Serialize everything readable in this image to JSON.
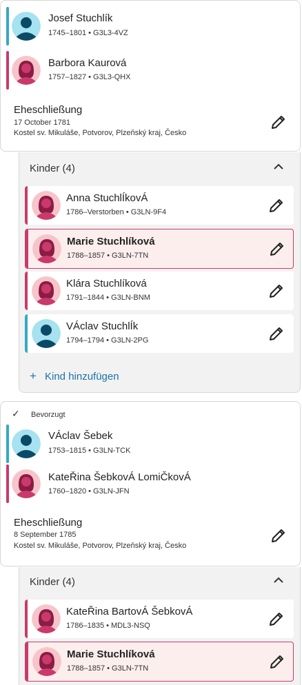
{
  "families": [
    {
      "father": {
        "name": "Josef Stuchlík",
        "meta": "1745–1801 • G3L3-4VZ"
      },
      "mother": {
        "name": "Barbora Kaurová",
        "meta": "1757–1827 • G3L3-QHX"
      },
      "marriage": {
        "title": "Eheschließung",
        "date": "17 October 1781",
        "place": "Kostel sv. Mikuláše, Potvorov, Plzeňský kraj, Česko"
      },
      "children_header": "Kinder (4)",
      "children": [
        {
          "name": "Anna StuchlÍkovÁ",
          "meta": "1786–Verstorben • G3LN-9F4"
        },
        {
          "name": "Marie Stuchlíková",
          "meta": "1788–1857 • G3LN-7TN"
        },
        {
          "name": "Klára Stuchlíková",
          "meta": "1791–1844 • G3LN-BNM"
        },
        {
          "name": "VÁclav StuchlÍk",
          "meta": "1794–1794 • G3LN-2PG"
        }
      ],
      "add_child": "Kind hinzufügen"
    },
    {
      "preferred_label": "Bevorzugt",
      "father": {
        "name": "VÁclav Šebek",
        "meta": "1753–1815 • G3LN-TCK"
      },
      "mother": {
        "name": "KateŘina ŠebkovÁ LomiČkovÁ",
        "meta": "1760–1820 • G3LN-JFN"
      },
      "marriage": {
        "title": "Eheschließung",
        "date": "8 September 1785",
        "place": "Kostel sv. Mikuláše, Potvorov, Plzeňský kraj, Česko"
      },
      "children_header": "Kinder (4)",
      "children": [
        {
          "name": "KateŘina BartovÁ ŠebkovÁ",
          "meta": "1786–1835 • MDL3-NSQ"
        },
        {
          "name": "Marie Stuchlíková",
          "meta": "1788–1857 • G3LN-7TN"
        }
      ]
    }
  ],
  "icons": {
    "male": "male-avatar-icon",
    "female": "female-avatar-icon",
    "edit": "pencil-icon",
    "collapse": "chevron-up-icon",
    "add": "plus-icon",
    "preferred": "check-icon"
  },
  "colors": {
    "male_accent": "#35a9c4",
    "female_accent": "#c93a6b",
    "link": "#1a73a8",
    "selected_bg": "#fdeeee"
  }
}
